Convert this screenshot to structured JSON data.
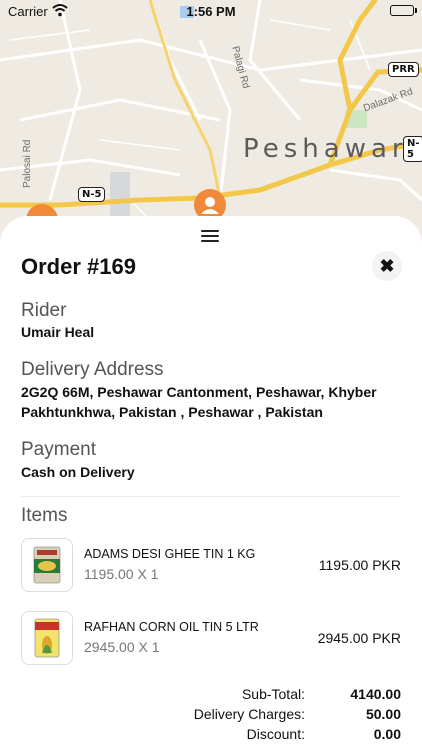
{
  "status_bar": {
    "carrier": "Carrier",
    "time": "1:56 PM"
  },
  "map": {
    "city": "Peshawar",
    "road_labels": [
      "Palosai Rd",
      "Palagi Rd",
      "Dalazak Rd"
    ],
    "shields": [
      "N-5",
      "N-5",
      "PRR"
    ],
    "road_color": "#f3c74a",
    "marker_color": "#f08a3a"
  },
  "order": {
    "title": "Order #169",
    "rider_label": "Rider",
    "rider_name": "Umair Heal",
    "address_label": "Delivery Address",
    "address": "2G2Q 66M, Peshawar Cantonment, Peshawar, Khyber Pakhtunkhwa, Pakistan , Peshawar , Pakistan",
    "payment_label": "Payment",
    "payment_method": "Cash on Delivery",
    "items_label": "Items",
    "items": [
      {
        "name": "ADAMS DESI GHEE TIN 1 KG",
        "qty": "1195.00 X 1",
        "price": "1195.00 PKR"
      },
      {
        "name": "RAFHAN CORN OIL TIN 5 LTR",
        "qty": "2945.00 X 1",
        "price": "2945.00 PKR"
      }
    ],
    "totals": {
      "subtotal_label": "Sub-Total:",
      "subtotal": "4140.00",
      "delivery_label": "Delivery Charges:",
      "delivery": "50.00",
      "discount_label": "Discount:",
      "discount": "0.00"
    }
  }
}
